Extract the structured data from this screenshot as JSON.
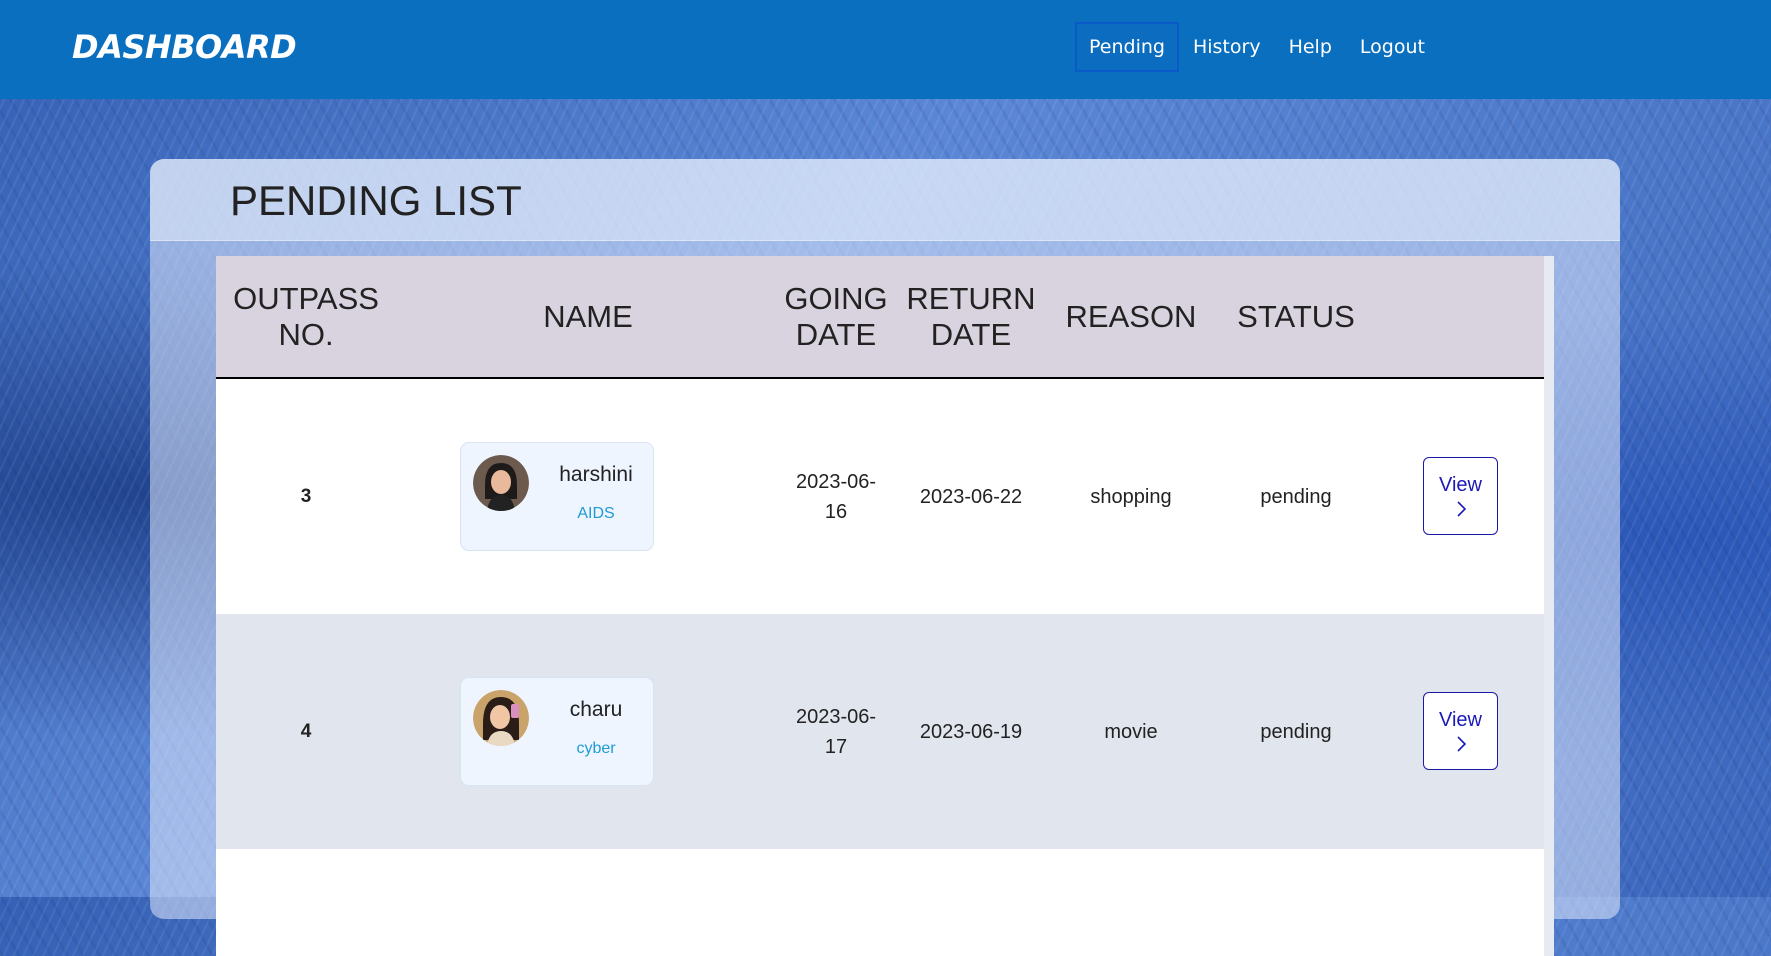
{
  "navbar": {
    "brand": "DASHBOARD",
    "links": [
      "Pending",
      "History",
      "Help",
      "Logout"
    ],
    "active": "Pending",
    "bg_color": "#0a6fbf"
  },
  "page": {
    "title": "PENDING LIST"
  },
  "table": {
    "headers": [
      "OUTPASS NO.",
      "NAME",
      "GOING DATE",
      "RETURN DATE",
      "REASON",
      "STATUS"
    ],
    "rows": [
      {
        "outpass_no": "3",
        "name": "harshini",
        "dept": "AIDS",
        "going_date": "2023-06-16",
        "return_date": "2023-06-22",
        "reason": "shopping",
        "status": "pending",
        "action": "View",
        "action_icon": "chevron-right-icon"
      },
      {
        "outpass_no": "4",
        "name": "charu",
        "dept": "cyber",
        "going_date": "2023-06-17",
        "return_date": "2023-06-19",
        "reason": "movie",
        "status": "pending",
        "action": "View",
        "action_icon": "chevron-right-icon"
      }
    ]
  }
}
